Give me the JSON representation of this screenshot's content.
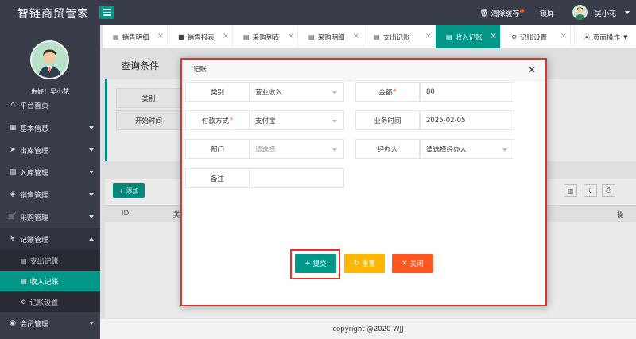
{
  "app": {
    "title": "智链商贸管家"
  },
  "header": {
    "clear_cache": "清除缓存",
    "lock": "锁屏",
    "user_name": "吴小花"
  },
  "sidebar": {
    "greeting": "你好！吴小花",
    "items": [
      {
        "label": "平台首页",
        "icon": "home-icon"
      },
      {
        "label": "基本信息",
        "icon": "grid-icon"
      },
      {
        "label": "出库管理",
        "icon": "send-icon"
      },
      {
        "label": "入库管理",
        "icon": "calendar-icon"
      },
      {
        "label": "销售管理",
        "icon": "tag-icon"
      },
      {
        "label": "采购管理",
        "icon": "cart-icon"
      },
      {
        "label": "记账管理",
        "icon": "yen-icon"
      },
      {
        "label": "会员管理",
        "icon": "user-circle-icon"
      }
    ],
    "sub_items": [
      {
        "label": "支出记账",
        "icon": "doc-icon"
      },
      {
        "label": "收入记账",
        "icon": "doc-icon"
      },
      {
        "label": "记账设置",
        "icon": "gear-icon"
      }
    ]
  },
  "tabs": [
    {
      "label": "销售明细"
    },
    {
      "label": "销售报表"
    },
    {
      "label": "采购列表"
    },
    {
      "label": "采购明细"
    },
    {
      "label": "支出记账"
    },
    {
      "label": "收入记账"
    },
    {
      "label": "记账设置"
    }
  ],
  "page_ops": "页面操作",
  "main": {
    "panel_title": "查询条件",
    "query_labels": [
      "类别",
      "开始时间"
    ],
    "add_button": "添加",
    "columns": [
      "ID",
      "类",
      "操"
    ]
  },
  "modal": {
    "title": "记账",
    "fields": {
      "category_label": "类别",
      "category_value": "营业收入",
      "amount_label": "金额",
      "amount_value": "80",
      "payment_label": "付款方式",
      "payment_value": "支付宝",
      "time_label": "业务时间",
      "time_value": "2025-02-05",
      "dept_label": "部门",
      "dept_placeholder": "请选择",
      "handler_label": "经办人",
      "handler_value": "请选择经办人",
      "remark_label": "备注",
      "remark_value": ""
    },
    "buttons": {
      "submit": "提交",
      "reset": "重置",
      "close": "关闭"
    }
  },
  "footer": {
    "copyright": "copyright @2020 WJJ"
  },
  "colors": {
    "header_bg": "#393d49",
    "accent": "#009688",
    "warn": "#ffb800",
    "danger": "#ff5722",
    "highlight": "#e0332f"
  }
}
